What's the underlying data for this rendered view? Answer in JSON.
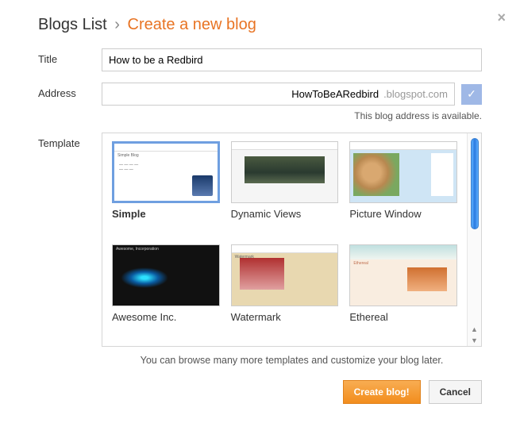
{
  "close_glyph": "×",
  "breadcrumb": {
    "blogs_list": "Blogs List",
    "separator": "›",
    "create": "Create a new blog"
  },
  "labels": {
    "title": "Title",
    "address": "Address",
    "template": "Template"
  },
  "title_value": "How to be a Redbird",
  "address": {
    "value": "HowToBeARedbird",
    "suffix": ".blogspot.com",
    "check_glyph": "✓",
    "available_msg": "This blog address is available."
  },
  "templates": [
    {
      "name": "Simple",
      "selected": true,
      "theme": "t-simple"
    },
    {
      "name": "Dynamic Views",
      "selected": false,
      "theme": "t-dynamic"
    },
    {
      "name": "Picture Window",
      "selected": false,
      "theme": "t-picture"
    },
    {
      "name": "Awesome Inc.",
      "selected": false,
      "theme": "t-awesome"
    },
    {
      "name": "Watermark",
      "selected": false,
      "theme": "t-water"
    },
    {
      "name": "Ethereal",
      "selected": false,
      "theme": "t-ethereal"
    }
  ],
  "browse_msg": "You can browse many more templates and customize your blog later.",
  "buttons": {
    "create": "Create blog!",
    "cancel": "Cancel"
  },
  "scroll": {
    "up": "▲",
    "down": "▼"
  },
  "thumb_texts": {
    "simple_title": "Simple Blog",
    "awesome_title": "Awesome, Incorporation",
    "ethereal_title": "Ethereal",
    "water_title": "Watermark"
  }
}
